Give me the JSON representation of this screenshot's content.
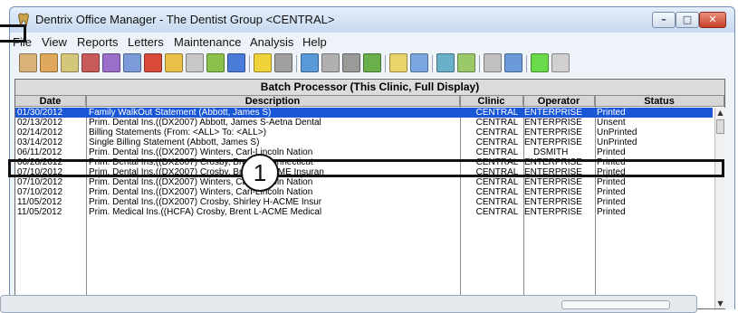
{
  "window": {
    "title": "Dentrix Office Manager - The Dentist Group <CENTRAL>"
  },
  "menu": [
    "File",
    "View",
    "Reports",
    "Letters",
    "Maintenance",
    "Analysis",
    "Help"
  ],
  "toolbar": {
    "groups": [
      [
        "patient-chart-icon",
        "family-file-icon",
        "ledger-icon",
        "treatment-planner-icon",
        "perio-chart-icon",
        "pen-icon",
        "book-icon",
        "appointment-book-icon",
        "document-center-icon",
        "rx-icon",
        "office-journal-icon"
      ],
      [
        "continuing-care-icon",
        "insurance-icon"
      ],
      [
        "computer-icon",
        "printer-icon",
        "trash-icon",
        "refresh-icon"
      ],
      [
        "question-icon",
        "help-icon"
      ],
      [
        "patients-icon",
        "providers-icon"
      ],
      [
        "binoculars-icon",
        "report-icon"
      ],
      [
        "smiley-icon",
        "signature-icon"
      ]
    ]
  },
  "batch": {
    "title": "Batch Processor (This Clinic, Full Display)",
    "columns": [
      "Date",
      "Description",
      "Clinic",
      "Operator",
      "Status"
    ],
    "rows": [
      {
        "date": "01/30/2012",
        "desc": "Family WalkOut Statement (Abbott, James S)",
        "clinic": "CENTRAL",
        "operator": "ENTERPRISE",
        "status": "Printed",
        "selected": true
      },
      {
        "date": "02/13/2012",
        "desc": "Prim. Dental Ins.((DX2007) Abbott, James S-Aetna Dental",
        "clinic": "CENTRAL",
        "operator": "ENTERPRISE",
        "status": "Unsent"
      },
      {
        "date": "02/14/2012",
        "desc": "Billing Statements (From: <ALL> To: <ALL>)",
        "clinic": "CENTRAL",
        "operator": "ENTERPRISE",
        "status": "UnPrinted"
      },
      {
        "date": "03/14/2012",
        "desc": "Single Billing Statement (Abbott, James S)",
        "clinic": "CENTRAL",
        "operator": "ENTERPRISE",
        "status": "UnPrinted"
      },
      {
        "date": "06/11/2012",
        "desc": "Prim. Dental Ins.((DX2007) Winters, Carl-Lincoln Nation",
        "clinic": "CENTRAL",
        "operator": "DSMITH",
        "status": "Printed"
      },
      {
        "date": "06/28/2012",
        "desc": "Prim. Dental Ins.((DX2007) Crosby, Brent L-Connecticut",
        "clinic": "CENTRAL",
        "operator": "ENTERPRISE",
        "status": "Printed"
      },
      {
        "date": "07/10/2012",
        "desc": "Prim. Dental Ins.((DX2007) Crosby, Brent L-ACME Insuran",
        "clinic": "CENTRAL",
        "operator": "ENTERPRISE",
        "status": "Printed"
      },
      {
        "date": "07/10/2012",
        "desc": "Prim. Dental Ins.((DX2007) Winters, Carl-Lincoln Nation",
        "clinic": "CENTRAL",
        "operator": "ENTERPRISE",
        "status": "Printed"
      },
      {
        "date": "07/10/2012",
        "desc": "Prim. Dental Ins.((DX2007) Winters, Carl-Lincoln Nation",
        "clinic": "CENTRAL",
        "operator": "ENTERPRISE",
        "status": "Printed"
      },
      {
        "date": "11/05/2012",
        "desc": "Prim. Dental Ins.((DX2007) Crosby, Shirley H-ACME Insur",
        "clinic": "CENTRAL",
        "operator": "ENTERPRISE",
        "status": "Printed"
      },
      {
        "date": "11/05/2012",
        "desc": "Prim. Medical Ins.((HCFA) Crosby, Brent L-ACME Medical",
        "clinic": "CENTRAL",
        "operator": "ENTERPRISE",
        "status": "Printed"
      }
    ]
  },
  "callout": {
    "number": "1"
  },
  "colors": {
    "selection": "#1a57d6",
    "title_bar": "#c8d9ef",
    "close_button": "#c8402a"
  }
}
